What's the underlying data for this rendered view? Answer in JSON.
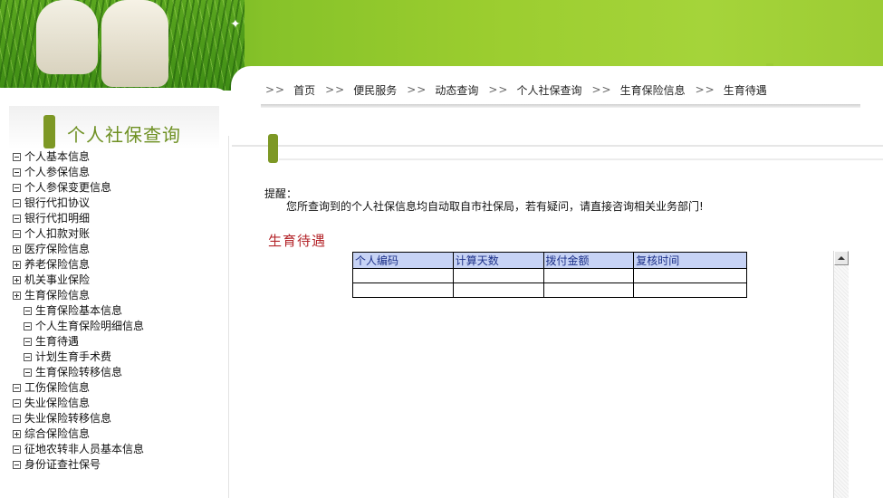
{
  "breadcrumb": {
    "separator": ">>",
    "items": [
      "首页",
      "便民服务",
      "动态查询",
      "个人社保查询",
      "生育保险信息",
      "生育待遇"
    ]
  },
  "sidebar": {
    "title": "个人社保查询",
    "items": [
      {
        "label": "个人基本信息",
        "state": "minus",
        "level": 0
      },
      {
        "label": "个人参保信息",
        "state": "minus",
        "level": 0
      },
      {
        "label": "个人参保变更信息",
        "state": "minus",
        "level": 0
      },
      {
        "label": "银行代扣协议",
        "state": "minus",
        "level": 0
      },
      {
        "label": "银行代扣明细",
        "state": "minus",
        "level": 0
      },
      {
        "label": "个人扣款对账",
        "state": "minus",
        "level": 0
      },
      {
        "label": "医疗保险信息",
        "state": "plus",
        "level": 0
      },
      {
        "label": "养老保险信息",
        "state": "plus",
        "level": 0
      },
      {
        "label": "机关事业保险",
        "state": "plus",
        "level": 0
      },
      {
        "label": "生育保险信息",
        "state": "plus",
        "level": 0
      },
      {
        "label": "生育保险基本信息",
        "state": "minus",
        "level": 1
      },
      {
        "label": "个人生育保险明细信息",
        "state": "minus",
        "level": 1
      },
      {
        "label": "生育待遇",
        "state": "minus",
        "level": 1
      },
      {
        "label": "计划生育手术费",
        "state": "minus",
        "level": 1
      },
      {
        "label": "生育保险转移信息",
        "state": "minus",
        "level": 1
      },
      {
        "label": "工伤保险信息",
        "state": "minus",
        "level": 0
      },
      {
        "label": "失业保险信息",
        "state": "minus",
        "level": 0
      },
      {
        "label": "失业保险转移信息",
        "state": "minus",
        "level": 0
      },
      {
        "label": "综合保险信息",
        "state": "plus",
        "level": 0
      },
      {
        "label": "征地农转非人员基本信息",
        "state": "minus",
        "level": 0
      },
      {
        "label": "身份证查社保号",
        "state": "minus",
        "level": 0
      }
    ]
  },
  "notice": {
    "label": "提醒：",
    "text": "您所查询到的个人社保信息均自动取自市社保局，若有疑问，请直接咨询相关业务部门!"
  },
  "page_title": "生育待遇",
  "table": {
    "columns": [
      "个人编码",
      "计算天数",
      "拨付金额",
      "复核时间"
    ],
    "rows": [
      [
        "",
        "",
        "",
        ""
      ],
      [
        "",
        "",
        "",
        ""
      ]
    ]
  },
  "colors": {
    "accent_green": "#7d9825",
    "title_red": "#b4262b",
    "header_bg": "#c7d3f5",
    "header_text": "#1b2f88"
  }
}
